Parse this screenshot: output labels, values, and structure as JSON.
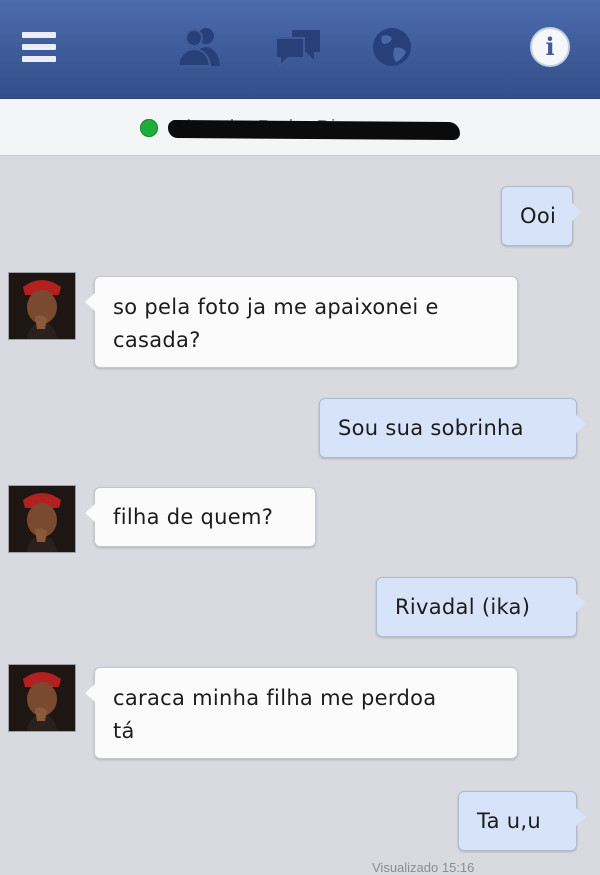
{
  "topbar": {
    "icons": [
      "menu-icon",
      "friends-icon",
      "messages-icon",
      "globe-icon",
      "info-icon"
    ],
    "info_label": "i"
  },
  "contact": {
    "name": "Rivandro Pedro Dias",
    "status_color": "#1fae3b"
  },
  "messages": [
    {
      "sender": "me",
      "lines": [
        "Ooi"
      ]
    },
    {
      "sender": "contact",
      "lines": [
        "so pela foto ja me apaixonei e",
        "casada?"
      ]
    },
    {
      "sender": "me",
      "lines": [
        "Sou sua sobrinha"
      ]
    },
    {
      "sender": "contact",
      "lines": [
        "filha de quem?"
      ]
    },
    {
      "sender": "me",
      "lines": [
        "Rivadal (ika)"
      ]
    },
    {
      "sender": "contact",
      "lines": [
        "caraca minha filha me perdoa",
        "tá"
      ]
    },
    {
      "sender": "me",
      "lines": [
        "Ta u,u"
      ]
    }
  ],
  "footer": {
    "timestamp": "Visualizado 15:16"
  }
}
